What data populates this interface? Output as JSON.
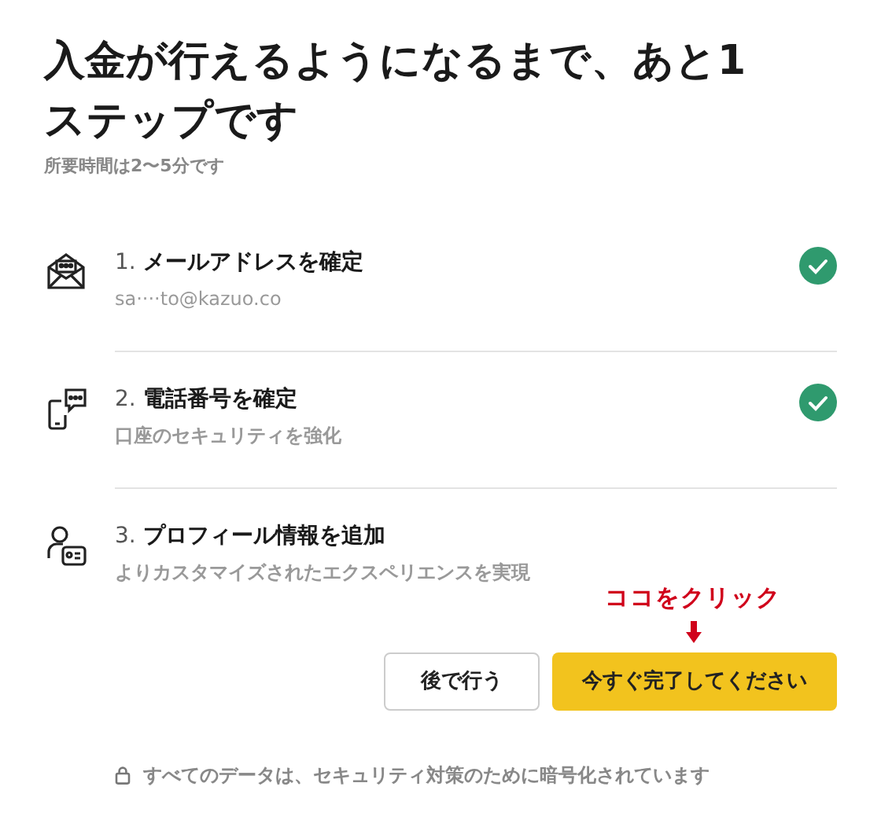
{
  "title": "入金が行えるようになるまで、あと1ステップです",
  "subtitle": "所要時間は2〜5分です",
  "steps": [
    {
      "kind": "email",
      "number": "1.",
      "title": "メールアドレスを確定",
      "detail": "sa····to@kazuo.co",
      "completed": true
    },
    {
      "kind": "phone",
      "number": "2.",
      "title": "電話番号を確定",
      "detail": "口座のセキュリティを強化",
      "completed": true
    },
    {
      "kind": "profile",
      "number": "3.",
      "title": "プロフィール情報を追加",
      "detail": "よりカスタマイズされたエクスペリエンスを実現",
      "completed": false
    }
  ],
  "annotation": "ココをクリック",
  "buttons": {
    "later": "後で行う",
    "primary": "今すぐ完了してください"
  },
  "footer": "すべてのデータは、セキュリティ対策のために暗号化されています"
}
